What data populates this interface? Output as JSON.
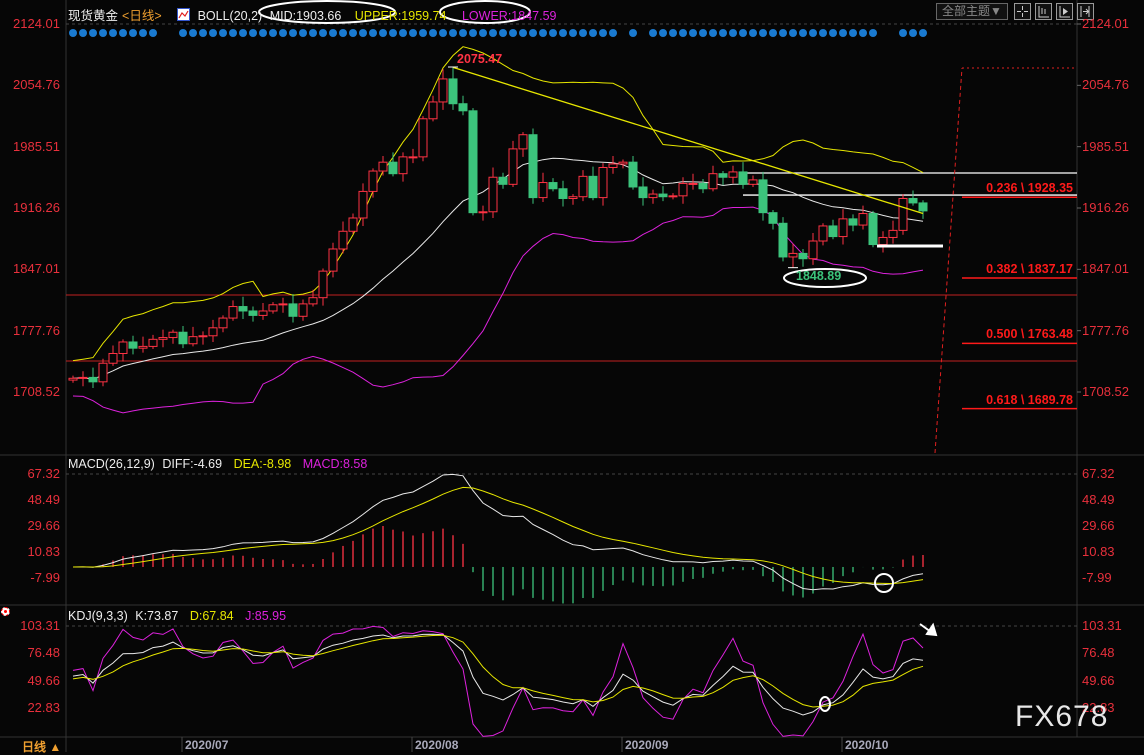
{
  "header": {
    "symbol": "现货黄金",
    "period": "<日线>",
    "indicator": "BOLL(20,2)",
    "mid": "MID:1903.66",
    "upper": "UPPER:1959.74",
    "lower": "LOWER:1847.59"
  },
  "toolbar": {
    "theme_label": "全部主题▼",
    "icons": [
      "crosshair-icon",
      "zoom-range-icon",
      "play-icon",
      "move-right-icon"
    ]
  },
  "macd_header": {
    "name": "MACD(26,12,9)",
    "diff": "DIFF:-4.69",
    "dea": "DEA:-8.98",
    "macd": "MACD:8.58"
  },
  "kdj_header": {
    "name": "KDJ(9,3,3)",
    "k": "K:73.87",
    "d": "D:67.84",
    "j": "J:85.95"
  },
  "period_switch": "日线 ▲",
  "watermark": "FX678",
  "colors": {
    "up": "#ff3344",
    "down": "#3cc47c",
    "upper": "#e6e600",
    "mid": "#e8e8e8",
    "lower": "#dd22dd",
    "axis": "#e8303c"
  },
  "chart_data": {
    "type": "candlestick",
    "title": "现货黄金 日线",
    "price_axis": {
      "range": [
        1708.52,
        2124.01
      ],
      "ticks": [
        "2124.01",
        "2054.76",
        "1985.51",
        "1916.26",
        "1847.01",
        "1777.76",
        "1708.52"
      ]
    },
    "macd_axis": {
      "range": [
        -7.99,
        67.32
      ],
      "ticks": [
        "67.32",
        "48.49",
        "29.66",
        "10.83",
        "-7.99"
      ]
    },
    "kdj_axis": {
      "range": [
        22.83,
        103.31
      ],
      "ticks": [
        "103.31",
        "76.48",
        "49.66",
        "22.83"
      ]
    },
    "x_ticks": [
      {
        "index": 11,
        "label": "2020/07"
      },
      {
        "index": 34,
        "label": "2020/08"
      },
      {
        "index": 55,
        "label": "2020/09"
      },
      {
        "index": 77,
        "label": "2020/10"
      }
    ],
    "first_open": 1722,
    "closes": [
      1724,
      1725,
      1720,
      1741,
      1752,
      1765,
      1758,
      1760,
      1768,
      1770,
      1776,
      1763,
      1771,
      1772,
      1781,
      1792,
      1805,
      1800,
      1795,
      1800,
      1807,
      1808,
      1794,
      1808,
      1815,
      1845,
      1870,
      1890,
      1905,
      1935,
      1958,
      1968,
      1955,
      1974,
      1974,
      2017,
      2036,
      2062,
      2034,
      2026,
      1911,
      1912,
      1951,
      1943,
      1983,
      1999,
      1928,
      1945,
      1938,
      1927,
      1929,
      1952,
      1928,
      1962,
      1966,
      1968,
      1940,
      1928,
      1932,
      1929,
      1930,
      1944,
      1944,
      1938,
      1955,
      1951,
      1957,
      1943,
      1948,
      1911,
      1899,
      1861,
      1865,
      1859,
      1879,
      1896,
      1884,
      1904,
      1897,
      1910,
      1875,
      1883,
      1891,
      1927,
      1922,
      1913
    ],
    "extremes": [
      {
        "index": 38,
        "type": "high",
        "value": 2075.47,
        "label": "2075.47"
      },
      {
        "index": 72,
        "type": "low",
        "value": 1848.89,
        "label": "1848.89"
      }
    ],
    "signal_dots_missing": [
      9,
      10,
      55,
      57,
      81,
      82
    ],
    "fibonacci": [
      {
        "ratio": "0.236",
        "value": 1928.35,
        "label": "0.236 \\ 1928.35"
      },
      {
        "ratio": "0.382",
        "value": 1837.17,
        "label": "0.382 \\ 1837.17"
      },
      {
        "ratio": "0.500",
        "value": 1763.48,
        "label": "0.500 \\ 1763.48"
      },
      {
        "ratio": "0.618",
        "value": 1689.78,
        "label": "0.618 \\ 1689.78"
      }
    ],
    "drawings": {
      "horizontal_red": [
        1818,
        1743.5
      ],
      "horizontal_white": [
        {
          "value": 1955.8,
          "from": 67
        },
        {
          "value": 1930.9,
          "from": 67
        }
      ],
      "support_white": {
        "value": 1873.4,
        "from": 80.4,
        "to": 87
      },
      "trendline_yellow": [
        {
          "index": 38,
          "value": 2075
        },
        {
          "index": 85,
          "value": 1910
        }
      ]
    }
  }
}
